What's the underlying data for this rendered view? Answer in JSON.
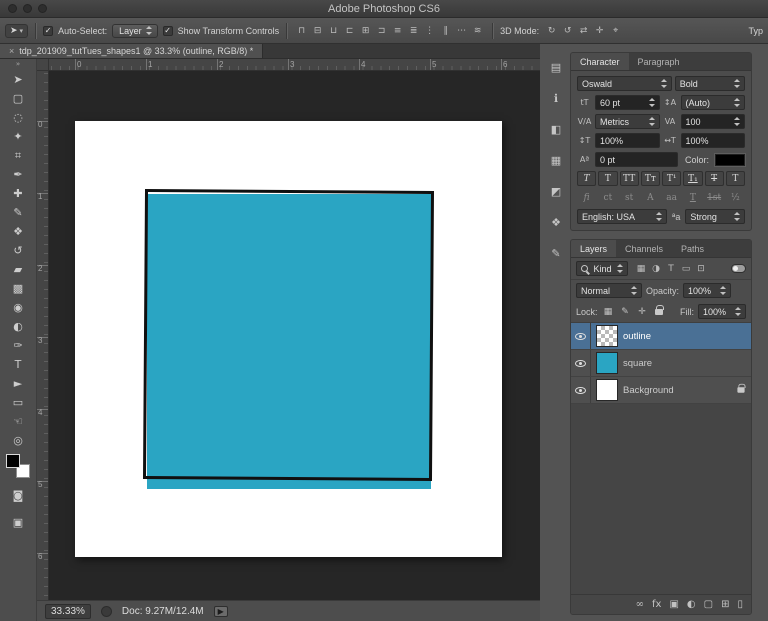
{
  "window": {
    "title": "Adobe Photoshop CS6",
    "workspace": "Typ"
  },
  "glyphs": {
    "check": "✓",
    "caret": "▾",
    "collapse": "»",
    "close_tab": "×",
    "flyout": "▶",
    "aa": "ªa",
    "tool_preset": "➤"
  },
  "options_bar": {
    "auto_select_label": "Auto-Select:",
    "auto_select_value": "Layer",
    "show_transform_label": "Show Transform Controls",
    "mode_3d_label": "3D Mode:",
    "align_icons": [
      {
        "name": "align-top-edges-icon",
        "glyph": "⊓"
      },
      {
        "name": "align-vertical-centers-icon",
        "glyph": "⊟"
      },
      {
        "name": "align-bottom-edges-icon",
        "glyph": "⊔"
      },
      {
        "name": "align-left-edges-icon",
        "glyph": "⊏"
      },
      {
        "name": "align-horizontal-centers-icon",
        "glyph": "⊞"
      },
      {
        "name": "align-right-edges-icon",
        "glyph": "⊐"
      },
      {
        "name": "distribute-top-edges-icon",
        "glyph": "≡"
      },
      {
        "name": "distribute-vertical-centers-icon",
        "glyph": "≣"
      },
      {
        "name": "distribute-bottom-edges-icon",
        "glyph": "⋮"
      },
      {
        "name": "distribute-left-edges-icon",
        "glyph": "∥"
      },
      {
        "name": "distribute-horizontal-centers-icon",
        "glyph": "⋯"
      },
      {
        "name": "distribute-right-edges-icon",
        "glyph": "≋"
      }
    ],
    "mode3d_icons": [
      {
        "name": "3d-rotate-icon",
        "glyph": "↻"
      },
      {
        "name": "3d-roll-icon",
        "glyph": "↺"
      },
      {
        "name": "3d-drag-icon",
        "glyph": "⇄"
      },
      {
        "name": "3d-slide-icon",
        "glyph": "✛"
      },
      {
        "name": "3d-scale-icon",
        "glyph": "⌖"
      }
    ]
  },
  "document_tab": {
    "title": "tdp_201909_tutTues_shapes1 @ 33.3% (outline, RGB/8) *"
  },
  "tools": [
    {
      "name": "move-tool",
      "glyph": "➤"
    },
    {
      "name": "marquee-tool",
      "glyph": "▢"
    },
    {
      "name": "lasso-tool",
      "glyph": "◌"
    },
    {
      "name": "magic-wand-tool",
      "glyph": "✦"
    },
    {
      "name": "crop-tool",
      "glyph": "⌗"
    },
    {
      "name": "eyedropper-tool",
      "glyph": "✒"
    },
    {
      "name": "healing-brush-tool",
      "glyph": "✚"
    },
    {
      "name": "brush-tool",
      "glyph": "✎"
    },
    {
      "name": "clone-stamp-tool",
      "glyph": "❖"
    },
    {
      "name": "history-brush-tool",
      "glyph": "↺"
    },
    {
      "name": "eraser-tool",
      "glyph": "▰"
    },
    {
      "name": "gradient-tool",
      "glyph": "▩"
    },
    {
      "name": "blur-tool",
      "glyph": "◉"
    },
    {
      "name": "dodge-tool",
      "glyph": "◐"
    },
    {
      "name": "pen-tool",
      "glyph": "✑"
    },
    {
      "name": "type-tool",
      "glyph": "T"
    },
    {
      "name": "path-selection-tool",
      "glyph": "►"
    },
    {
      "name": "shape-tool",
      "glyph": "▭"
    },
    {
      "name": "hand-tool",
      "glyph": "☜"
    },
    {
      "name": "zoom-tool",
      "glyph": "◎"
    }
  ],
  "extra_tools": [
    {
      "name": "quick-mask-button",
      "glyph": "◙"
    },
    {
      "name": "screen-mode-button",
      "glyph": "▣"
    }
  ],
  "rulers": {
    "top": [
      "0",
      "1",
      "2",
      "3",
      "4",
      "5",
      "6"
    ],
    "left": [
      "0",
      "1",
      "2",
      "3",
      "4",
      "5",
      "6"
    ]
  },
  "character_panel": {
    "tabs": {
      "character": "Character",
      "paragraph": "Paragraph"
    },
    "font_family": "Oswald",
    "font_style": "Bold",
    "size_value": "60 pt",
    "leading_value": "(Auto)",
    "kerning_value": "Metrics",
    "tracking_value": "100",
    "vertical_scale": "100%",
    "horizontal_scale": "100%",
    "baseline_value": "0 pt",
    "color_label": "Color:",
    "language_value": "English: USA",
    "anti_alias_value": "Strong",
    "icons": {
      "size": "tT",
      "leading": "↕A",
      "kerning": "V/A",
      "tracking": "VA",
      "vscale": "↕T",
      "hscale": "↔T",
      "baseline": "Aª"
    },
    "style_buttons": [
      {
        "name": "faux-bold-icon",
        "glyph": "T"
      },
      {
        "name": "faux-italic-icon",
        "glyph": "T"
      },
      {
        "name": "all-caps-icon",
        "glyph": "TT"
      },
      {
        "name": "small-caps-icon",
        "glyph": "Tᴛ"
      },
      {
        "name": "superscript-icon",
        "glyph": "T¹"
      },
      {
        "name": "subscript-icon",
        "glyph": "T₁"
      },
      {
        "name": "underline-icon",
        "glyph": "T"
      },
      {
        "name": "strikethrough-icon",
        "glyph": "T"
      }
    ],
    "opentype_buttons": [
      {
        "name": "standard-ligatures-icon",
        "glyph": "fi"
      },
      {
        "name": "contextual-alternates-icon",
        "glyph": "ct"
      },
      {
        "name": "discretionary-ligatures-icon",
        "glyph": "st"
      },
      {
        "name": "swash-icon",
        "glyph": "A"
      },
      {
        "name": "stylistic-alternates-icon",
        "glyph": "aa"
      },
      {
        "name": "titling-alternates-icon",
        "glyph": "T"
      },
      {
        "name": "ordinals-icon",
        "glyph": "1st"
      },
      {
        "name": "fractions-icon",
        "glyph": "½"
      }
    ]
  },
  "collapsed_panels": [
    {
      "name": "history-panel-icon",
      "glyph": "▤"
    },
    {
      "name": "properties-panel-icon",
      "glyph": "ℹ"
    },
    {
      "name": "color-panel-icon",
      "glyph": "◧"
    },
    {
      "name": "swatches-panel-icon",
      "glyph": "▦"
    },
    {
      "name": "adjustments-panel-icon",
      "glyph": "◩"
    },
    {
      "name": "styles-panel-icon",
      "glyph": "❖"
    },
    {
      "name": "brush-panel-icon",
      "glyph": "✎"
    }
  ],
  "layers_panel": {
    "tabs": [
      "Layers",
      "Channels",
      "Paths"
    ],
    "filter_label": "Kind",
    "filter_icons": [
      {
        "name": "filter-pixel-layers-icon",
        "glyph": "▦"
      },
      {
        "name": "filter-adjustment-layers-icon",
        "glyph": "◑"
      },
      {
        "name": "filter-type-layers-icon",
        "glyph": "T"
      },
      {
        "name": "filter-shape-layers-icon",
        "glyph": "▭"
      },
      {
        "name": "filter-smart-objects-icon",
        "glyph": "⊡"
      }
    ],
    "blend_mode": "Normal",
    "opacity_label": "Opacity:",
    "opacity_value": "100%",
    "lock_label": "Lock:",
    "lock_icons": [
      {
        "name": "lock-transparent-pixels-icon",
        "glyph": "▦"
      },
      {
        "name": "lock-image-pixels-icon",
        "glyph": "✎"
      },
      {
        "name": "lock-position-icon",
        "glyph": "✛"
      }
    ],
    "fill_label": "Fill:",
    "fill_value": "100%",
    "layers": [
      {
        "name": "outline"
      },
      {
        "name": "square"
      },
      {
        "name": "Background"
      }
    ],
    "bottom_icons": [
      {
        "name": "link-layers-icon",
        "glyph": "∞"
      },
      {
        "name": "layer-effects-icon",
        "glyph": "fx"
      },
      {
        "name": "layer-mask-icon",
        "glyph": "▣"
      },
      {
        "name": "adjustment-layer-icon",
        "glyph": "◐"
      },
      {
        "name": "layer-group-icon",
        "glyph": "▢"
      },
      {
        "name": "new-layer-icon",
        "glyph": "⊞"
      },
      {
        "name": "delete-layer-icon",
        "glyph": "▯"
      }
    ]
  },
  "status_bar": {
    "zoom": "33.33%",
    "doc_label": "Doc: 9.27M/12.4M"
  },
  "colors": {
    "teal": "#2aa5c3",
    "selected_layer": "#4a7095",
    "outline_stroke": "#101010"
  }
}
